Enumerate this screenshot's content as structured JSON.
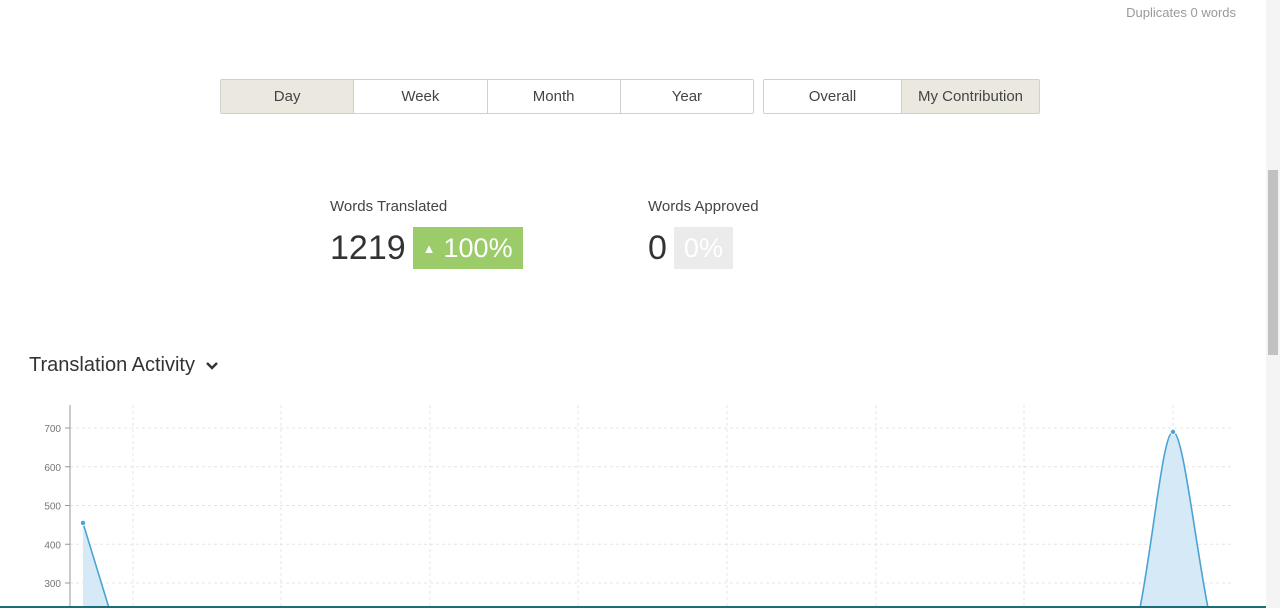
{
  "header": {
    "duplicates": "Duplicates 0 words"
  },
  "period_buttons": [
    {
      "label": "Day",
      "active": true
    },
    {
      "label": "Week",
      "active": false
    },
    {
      "label": "Month",
      "active": false
    },
    {
      "label": "Year",
      "active": false
    }
  ],
  "scope_buttons": [
    {
      "label": "Overall",
      "active": false
    },
    {
      "label": "My Contribution",
      "active": true
    }
  ],
  "stats": {
    "translated": {
      "label": "Words Translated",
      "value": "1219",
      "change": "100%",
      "change_icon": "triangle-up-icon"
    },
    "approved": {
      "label": "Words Approved",
      "value": "0",
      "change": "0%"
    }
  },
  "section": {
    "title": "Translation Activity"
  },
  "colors": {
    "accent_green": "#9ccb6a",
    "active_button": "#ebe8df",
    "line": "#4aa3d6",
    "area_fill": "#d6e9f6"
  },
  "chart_data": {
    "type": "area",
    "yticks": [
      300,
      400,
      500,
      600,
      700
    ],
    "ylim": [
      240,
      760
    ],
    "series": [
      {
        "values": [
          {
            "x": 0,
            "y": 455
          },
          {
            "x": 0.4,
            "y": 250
          },
          {
            "x": 25.6,
            "y": 250
          },
          {
            "x": 26,
            "y": 690
          },
          {
            "x": 26.4,
            "y": 250
          }
        ]
      }
    ],
    "xlim": [
      0,
      27
    ],
    "grid": true,
    "points_marked": [
      {
        "x": 0,
        "y": 455
      },
      {
        "x": 26,
        "y": 690
      }
    ]
  }
}
